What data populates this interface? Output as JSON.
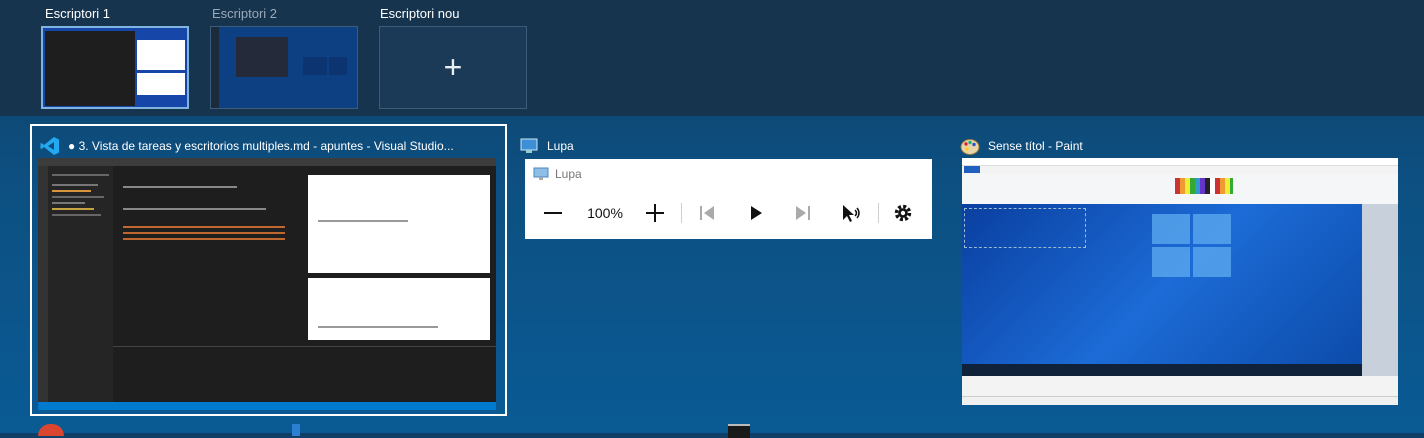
{
  "desktops": [
    {
      "label": "Escriptori 1",
      "state": "active"
    },
    {
      "label": "Escriptori 2",
      "state": "inactive"
    },
    {
      "label": "Escriptori nou",
      "state": "new",
      "icon": "plus-icon"
    }
  ],
  "windows": [
    {
      "title": "● 3. Vista de tareas y escritorios multiples.md - apuntes - Visual Studio...",
      "icon": "vscode-icon",
      "selected": true
    },
    {
      "title": "Lupa",
      "icon": "magnifier-icon",
      "selected": false
    },
    {
      "title": "Sense títol - Paint",
      "icon": "paint-icon",
      "selected": false
    }
  ],
  "lupa": {
    "caption": "Lupa",
    "zoom": "100%",
    "controls": [
      "zoom-out-icon",
      "zoom-in-icon",
      "previous-icon",
      "play-icon",
      "next-icon",
      "read-from-cursor-icon",
      "settings-icon"
    ]
  },
  "colors": {
    "accent": "#7fb3e0",
    "topbar": "#17344f",
    "background": "#0d4f80",
    "vscode_blue": "#23a9f2",
    "paint_blue": "#1f5fbf"
  }
}
